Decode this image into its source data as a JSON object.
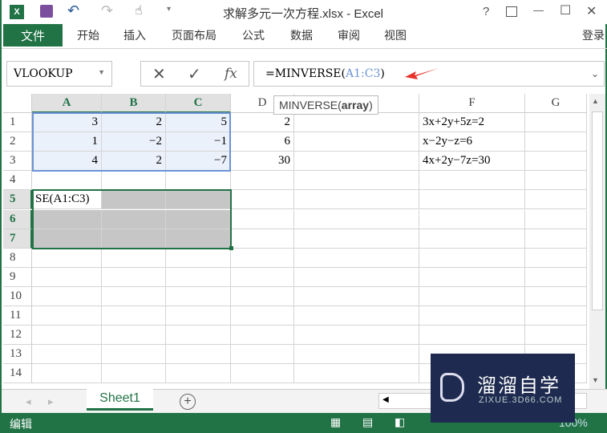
{
  "window": {
    "title": "求解多元一次方程.xlsx - Excel",
    "help": "?",
    "minimize": "—",
    "maximize": "☐",
    "close": "✕"
  },
  "ribbon": {
    "file": "文件",
    "tabs": [
      "开始",
      "插入",
      "页面布局",
      "公式",
      "数据",
      "审阅",
      "视图"
    ],
    "login": "登录"
  },
  "formula_bar": {
    "name_box": "VLOOKUP",
    "cancel": "✕",
    "enter": "✓",
    "fx": "fx",
    "formula_prefix": "=MINVERSE(",
    "formula_ref": "A1:C3",
    "formula_suffix": ")",
    "tooltip_fn": "MINVERSE(",
    "tooltip_arg": "array",
    "tooltip_end": ")"
  },
  "columns": [
    "A",
    "B",
    "C",
    "D",
    "E",
    "F",
    "G"
  ],
  "rows": [
    "1",
    "2",
    "3",
    "4",
    "5",
    "6",
    "7",
    "8",
    "9",
    "10",
    "11",
    "12",
    "13",
    "14"
  ],
  "cells": {
    "A1": "3",
    "B1": "2",
    "C1": "5",
    "D1": "2",
    "F1": "3x+2y+5z=2",
    "A2": "1",
    "B2": "−2",
    "C2": "−1",
    "D2": "6",
    "F2": "x−2y−z=6",
    "A3": "4",
    "B3": "2",
    "C3": "−7",
    "D3": "30",
    "F3": "4x+2y−7z=30",
    "A5": "SE(A1:C3)"
  },
  "sheets": {
    "active": "Sheet1",
    "add": "+"
  },
  "status": {
    "mode": "编辑",
    "zoom": "100%"
  },
  "watermark": {
    "name": "溜溜自学",
    "url": "ZIXUE.3D66.COM"
  },
  "colors": {
    "excel_green": "#217346",
    "range_blue": "#6b93d6",
    "arrow_red": "#e8312a"
  }
}
